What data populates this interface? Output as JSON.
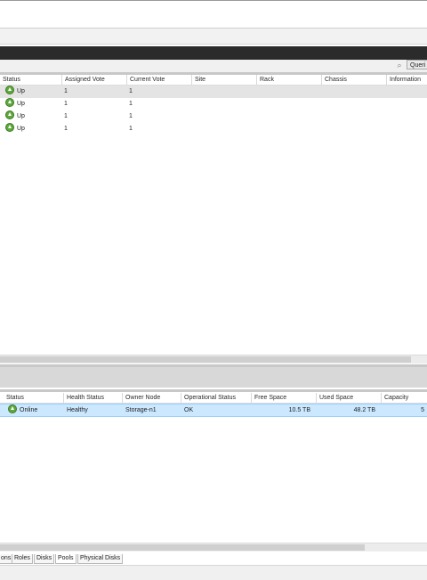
{
  "queries_label": "Queri",
  "nodes": {
    "columns": [
      "Status",
      "Assigned Vote",
      "Current Vote",
      "Site",
      "Rack",
      "Chassis",
      "Information"
    ],
    "rows": [
      {
        "status": "Up",
        "assigned": "1",
        "current": "1"
      },
      {
        "status": "Up",
        "assigned": "1",
        "current": "1"
      },
      {
        "status": "Up",
        "assigned": "1",
        "current": "1"
      },
      {
        "status": "Up",
        "assigned": "1",
        "current": "1"
      }
    ]
  },
  "pools": {
    "columns": [
      "Status",
      "Health Status",
      "Owner Node",
      "Operational Status",
      "Free Space",
      "Used Space",
      "Capacity"
    ],
    "rows": [
      {
        "status": "Online",
        "health": "Healthy",
        "owner": "Storage-n1",
        "op": "OK",
        "free": "10.5 TB",
        "used": "48.2 TB",
        "capacity": "5"
      }
    ]
  },
  "tabs": [
    "ons",
    "Roles",
    "Disks",
    "Pools",
    "Physical Disks"
  ],
  "active_tab": "Pools",
  "colors": {
    "selection": "#cce8ff",
    "dark_bar": "#2b2b2b",
    "status_icon": "#5fa83c"
  }
}
